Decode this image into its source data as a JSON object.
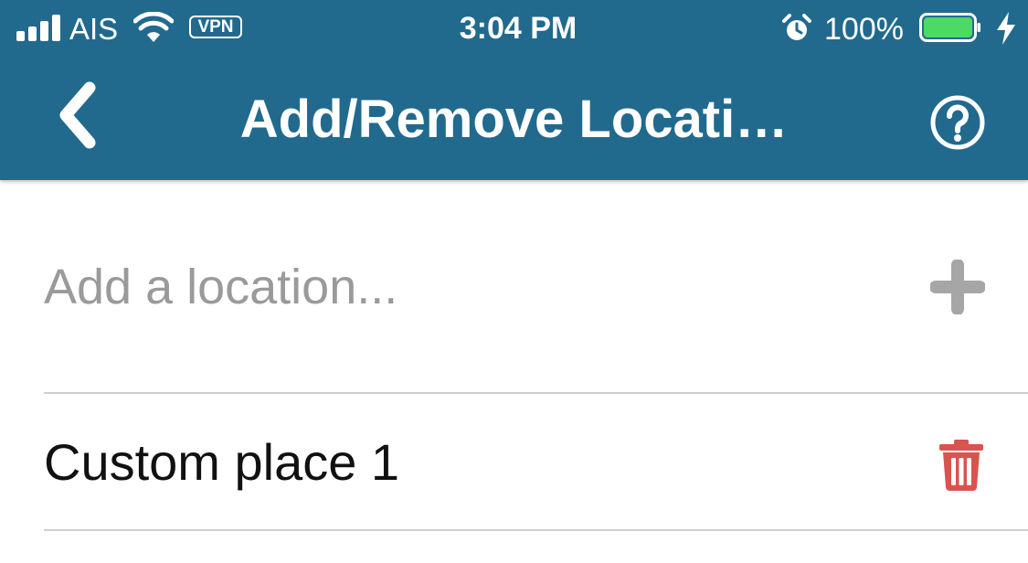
{
  "status_bar": {
    "carrier": "AIS",
    "vpn_label": "VPN",
    "time": "3:04 PM",
    "battery_percent": "100%",
    "battery_level": 1.0,
    "icons": [
      "signal-bars-icon",
      "wifi-icon",
      "alarm-icon",
      "battery-icon",
      "charging-bolt-icon"
    ]
  },
  "nav": {
    "title": "Add/Remove Locati…",
    "back_icon": "chevron-left-icon",
    "help_icon": "question-circle-icon"
  },
  "add_location": {
    "placeholder": "Add a location...",
    "value": "",
    "add_icon": "plus-icon"
  },
  "locations": [
    {
      "name": "Custom place 1",
      "delete_icon": "trash-icon"
    }
  ],
  "colors": {
    "header": "#216a8e",
    "delete": "#d9534f",
    "add_icon": "#a6a6a6",
    "battery_fill": "#4cd964",
    "placeholder": "#9a9a9a"
  }
}
